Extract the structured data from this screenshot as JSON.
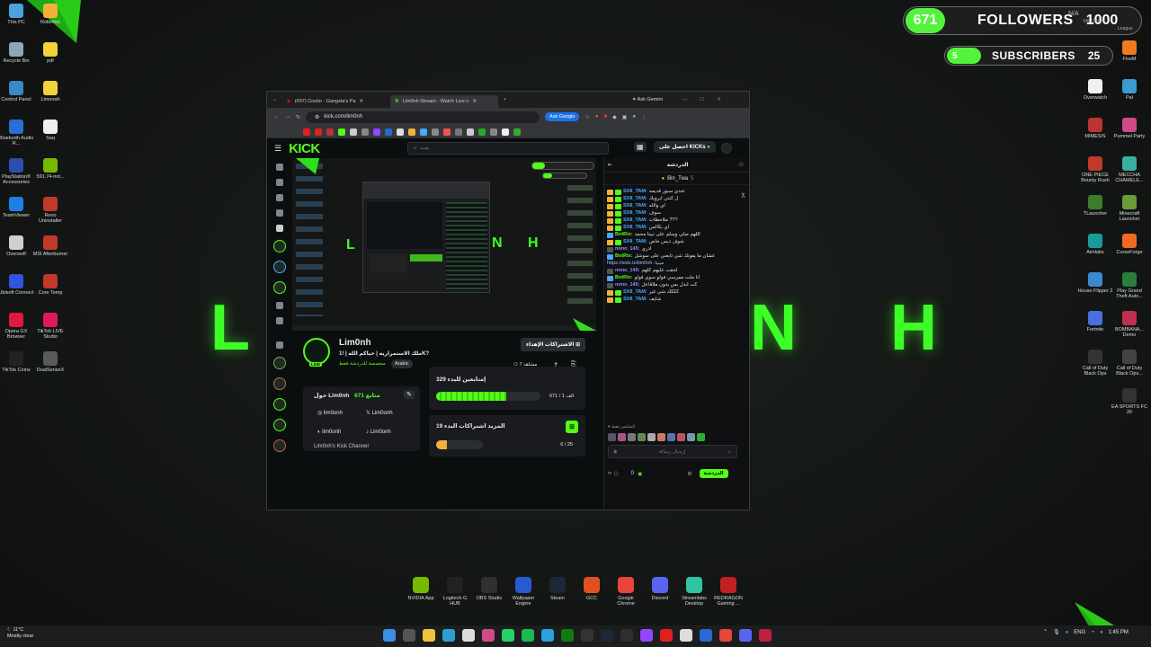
{
  "overlay": {
    "followers_count": "671",
    "followers_label": "FOLLOWERS",
    "followers_goal": "1000",
    "subscribers_count": "5",
    "subscribers_label": "SUBSCRIBERS",
    "subscribers_goal": "25",
    "background_letters": [
      "L",
      "N",
      "H"
    ],
    "status_text": "N/A",
    "status_game": "VALORAN",
    "status_league": "League"
  },
  "desktop_left": [
    {
      "label": "This PC",
      "color": "#4aa3df"
    },
    {
      "label": "Recycle Bin",
      "color": "#8fa6b8"
    },
    {
      "label": "Control Panel",
      "color": "#3b88c3"
    },
    {
      "label": "Bluetooth Audio R...",
      "color": "#2b6fd6"
    },
    {
      "label": "PlayStation® Accessories",
      "color": "#2a4fb0"
    },
    {
      "label": "TeamViewer",
      "color": "#1d7ee6"
    },
    {
      "label": "Overwolf",
      "color": "#d0d0d0"
    },
    {
      "label": "Ubisoft Connect",
      "color": "#3353e0"
    },
    {
      "label": "Opera GX Browser",
      "color": "#e0193a"
    },
    {
      "label": "TikTok Coins",
      "color": "#222"
    }
  ],
  "desktop_left2": [
    {
      "label": "Robinhm",
      "color": "#f2b23a"
    },
    {
      "label": "pdf",
      "color": "#f2d23a"
    },
    {
      "label": "Limonah",
      "color": "#f2d23a"
    },
    {
      "label": "Saq",
      "color": "#f0f0f0"
    },
    {
      "label": "591.74-not...",
      "color": "#76b900"
    },
    {
      "label": "Revo Uninstaller",
      "color": "#c0392b"
    },
    {
      "label": "MSI Afterburner",
      "color": "#c0392b"
    },
    {
      "label": "Core Temp",
      "color": "#c0392b"
    },
    {
      "label": "TikTok LIVE Studio",
      "color": "#e0195a"
    },
    {
      "label": "DualSenseX",
      "color": "#5a5a5a"
    }
  ],
  "desktop_right": [
    {
      "label": "Overwatch",
      "color": "#f0f0f0"
    },
    {
      "label": "MIMESIS",
      "color": "#b33"
    },
    {
      "label": "ONE PIECE Bounty Rush",
      "color": "#c0392b"
    },
    {
      "label": "TLauncher",
      "color": "#3a7d2a"
    },
    {
      "label": "Aimlabs",
      "color": "#1a9b9b"
    },
    {
      "label": "House Flipper 2",
      "color": "#3a8ad0"
    },
    {
      "label": "Fortnite",
      "color": "#4a6fe0"
    },
    {
      "label": "Call of Duty Black Ops",
      "color": "#333"
    }
  ],
  "desktop_right2": [
    {
      "label": "FiveM",
      "color": "#f07a20"
    },
    {
      "label": "Pal",
      "color": "#3a9bd0"
    },
    {
      "label": "Pummel Party",
      "color": "#d04a8a"
    },
    {
      "label": "MECCHA CHAMELE...",
      "color": "#3ab0a0"
    },
    {
      "label": "Minecraft Launcher",
      "color": "#6a9b3a"
    },
    {
      "label": "CurseForge",
      "color": "#f06a20"
    },
    {
      "label": "Play Grand Theft Auto...",
      "color": "#2a7d3a"
    },
    {
      "label": "BOMBANA... Demo",
      "color": "#c03050"
    },
    {
      "label": "Call of Duty Black Ops...",
      "color": "#444"
    },
    {
      "label": "EA SPORTS FC 26",
      "color": "#333"
    }
  ],
  "dock": [
    {
      "label": "NVIDIA App",
      "color": "#76b900"
    },
    {
      "label": "Logitech G HUB",
      "color": "#222"
    },
    {
      "label": "OBS Studio",
      "color": "#303030"
    },
    {
      "label": "Wallpaper Engine",
      "color": "#2a5ad0"
    },
    {
      "label": "Steam",
      "color": "#1b2838"
    },
    {
      "label": "GCC",
      "color": "#e05020"
    },
    {
      "label": "Google Chrome",
      "color": "#e8453c"
    },
    {
      "label": "Discord",
      "color": "#5865f2"
    },
    {
      "label": "Streamlabs Desktop",
      "color": "#31c3a2"
    },
    {
      "label": "REDRAGON Gaming ...",
      "color": "#c02020"
    }
  ],
  "browser": {
    "tab1": "(497) Coolio - Gangsta's Pa",
    "tab2": "Lim0nh Stream - Watch Live o",
    "ask_gemini": "Ask Gemini",
    "url": "kick.com/lim0nh",
    "ask_google": "Ask Google"
  },
  "kick": {
    "logo": "KICK",
    "search_placeholder": "بحث",
    "get_kicks": "احصل على KICKs",
    "streamer_name": "Lim0nh",
    "live_badge": "LIVE",
    "stream_title": "ملك الاستمراريه | حياكم الله | !1K?",
    "category": "مخصصة للدردشة فقط",
    "language_tag": "Arabic",
    "viewers": "7 مشاهد",
    "subscribe_button": "الاشتراكات الإهداء",
    "about_title": "حول Lim0nh",
    "followers_line": "671 متابع",
    "socials": [
      {
        "name": "lim0onh",
        "icon": "instagram-icon"
      },
      {
        "name": "Lim0onh",
        "icon": "x-icon"
      },
      {
        "name": "lim0onh",
        "icon": "discord-icon"
      },
      {
        "name": "Lim0onh",
        "icon": "tiktok-icon"
      }
    ],
    "channel_desc": "Lim0nh's Kick Channel",
    "goal1_title": "إمتابعين للبدء 329",
    "goal1_progress": "671 / 1 الف",
    "goal1_fill": 0.67,
    "goal2_title": "المزيد اشتراكات البدء 19",
    "goal2_progress": "6 / 25",
    "goal2_fill": 0.24
  },
  "chat": {
    "title": "الدردشة",
    "pinned": "Bin_Twa",
    "pinned_count": "5",
    "messages": [
      {
        "user": "SX8_TAM",
        "text": "عندي سبور قديمه",
        "color": "#4aa8ff"
      },
      {
        "user": "SX8_TAM",
        "text": "ل كنتي ابروبك",
        "color": "#4aa8ff"
      },
      {
        "user": "SX8_TAM",
        "text": "اي والله",
        "color": "#4aa8ff"
      },
      {
        "user": "SX8_TAM",
        "text": "سوف",
        "color": "#4aa8ff"
      },
      {
        "user": "SX8_TAM",
        "text": "ملاحظات ???",
        "color": "#4aa8ff"
      },
      {
        "user": "SX8_TAM",
        "text": "اي بكالس",
        "color": "#4aa8ff"
      },
      {
        "user": "BotRix",
        "text": "اللهم صلي وسلم على نبينا محمد",
        "color": "#53fc18"
      },
      {
        "user": "SX8_TAM",
        "text": "شوف ديس خاص",
        "color": "#4aa8ff"
      },
      {
        "user": "nono_145",
        "text": "ادري",
        "color": "#9e8cff"
      },
      {
        "user": "BotRix",
        "text": "عشان ما يفوتك شي تابعني على سوشل",
        "color": "#53fc18"
      },
      {
        "user": "",
        "text": "https://solo.to/lim0nh :مينيا",
        "color": "#9ec8ff"
      },
      {
        "user": "nono_145",
        "text": "لحقت عليهم كلهم",
        "color": "#9e8cff"
      },
      {
        "user": "BotRix",
        "text": "انا ملت ممرسي فولو سوي فولو",
        "color": "#53fc18"
      },
      {
        "user": "nono_145",
        "text": "كت ابدل بس بدون ملاقاعل",
        "color": "#9e8cff"
      },
      {
        "user": "SX8_TAM",
        "text": "كككك شي غير",
        "color": "#4aa8ff"
      },
      {
        "user": "SX8_TAM",
        "text": "شايف",
        "color": "#4aa8ff"
      }
    ],
    "viewers_label": "المتابعين فقط",
    "input_placeholder": "إرسال رسالة",
    "kicks_count": "0",
    "send_button": "الدردشة"
  },
  "taskbar": {
    "weather_temp": "11°C",
    "weather_desc": "Mostly clear",
    "lang": "ENG",
    "time": "1:45 PM"
  }
}
